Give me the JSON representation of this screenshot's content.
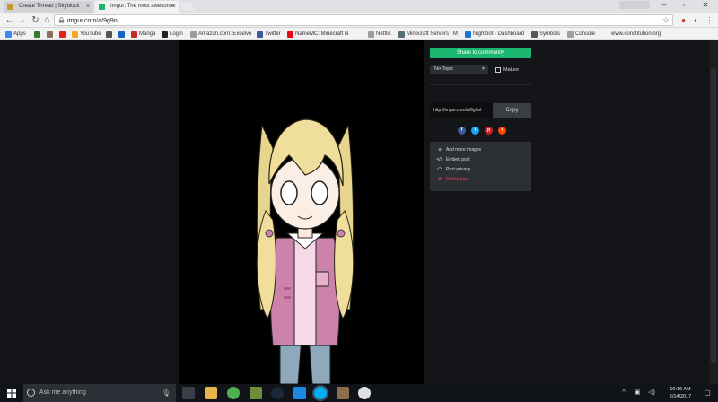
{
  "browser": {
    "tabs": [
      {
        "label": "Create Thread | Skyblock",
        "icon": "skyblock-icon"
      },
      {
        "label": "Imgur: The most awesome",
        "icon": "imgur-icon"
      }
    ],
    "url": "imgur.com/a/9g9ol",
    "bookmarks": [
      {
        "label": "Apps",
        "color": "#4285f4"
      },
      {
        "label": "",
        "color": "#2e7d32"
      },
      {
        "label": "",
        "color": "#8d6e63"
      },
      {
        "label": "YouTube",
        "color": "#e62117"
      },
      {
        "label": "",
        "color": "#f9a825"
      },
      {
        "label": "",
        "color": "#555555"
      },
      {
        "label": "Manga",
        "color": "#1565c0"
      },
      {
        "label": "Login",
        "color": "#c62828"
      },
      {
        "label": "Amazon.com: Excelvo",
        "color": "#222222"
      },
      {
        "label": "Twitter",
        "color": "#9e9e9e"
      },
      {
        "label": "NameMC: Minecraft N",
        "color": "#3b5998"
      },
      {
        "label": "Netflix",
        "color": "#e50914"
      },
      {
        "label": "Minecraft Servers | M",
        "color": "#9e9e9e"
      },
      {
        "label": "Nightbot - Dashboard",
        "color": "#546e7a"
      },
      {
        "label": "Symbols",
        "color": "#1976d2"
      },
      {
        "label": "Console",
        "color": "#555555"
      },
      {
        "label": "www.constitution.org",
        "color": "#9e9e9e"
      }
    ]
  },
  "sidebar": {
    "share_label": "Share to community",
    "topic_selected": "No Topic",
    "mature_label": "Mature",
    "link_value": "http://imgur.com/a/9g9ol",
    "copy_label": "Copy",
    "social": [
      {
        "name": "facebook",
        "glyph": "f",
        "color": "#3b5998"
      },
      {
        "name": "twitter",
        "glyph": "t",
        "color": "#1da1f2"
      },
      {
        "name": "pinterest",
        "glyph": "p",
        "color": "#cb2027"
      },
      {
        "name": "reddit",
        "glyph": "r",
        "color": "#ff4500"
      }
    ],
    "menu": [
      {
        "label": "Add more images",
        "icon": "plus-icon",
        "glyph": "+"
      },
      {
        "label": "Embed post",
        "icon": "code-icon",
        "glyph": "</>"
      },
      {
        "label": "Post privacy",
        "icon": "eye-icon",
        "glyph": "◠"
      },
      {
        "label": "Delete post",
        "icon": "trash-icon",
        "glyph": "✖",
        "danger": true
      }
    ]
  },
  "taskbar": {
    "search_placeholder": "Ask me anything",
    "apps": [
      {
        "name": "task-view",
        "color": "#3a3f47"
      },
      {
        "name": "file-explorer",
        "color": "#e8b54a"
      },
      {
        "name": "chrome",
        "color": "#4caf50"
      },
      {
        "name": "minecraft",
        "color": "#6d8f3a"
      },
      {
        "name": "steam",
        "color": "#1b2838"
      },
      {
        "name": "app-blue",
        "color": "#1e88e5"
      },
      {
        "name": "skype",
        "color": "#00aff0"
      },
      {
        "name": "minecraft-2",
        "color": "#8d6e4b"
      },
      {
        "name": "app-penguin",
        "color": "#e0e0e0"
      }
    ],
    "time": "10:16 AM",
    "date": "2/14/2017"
  }
}
